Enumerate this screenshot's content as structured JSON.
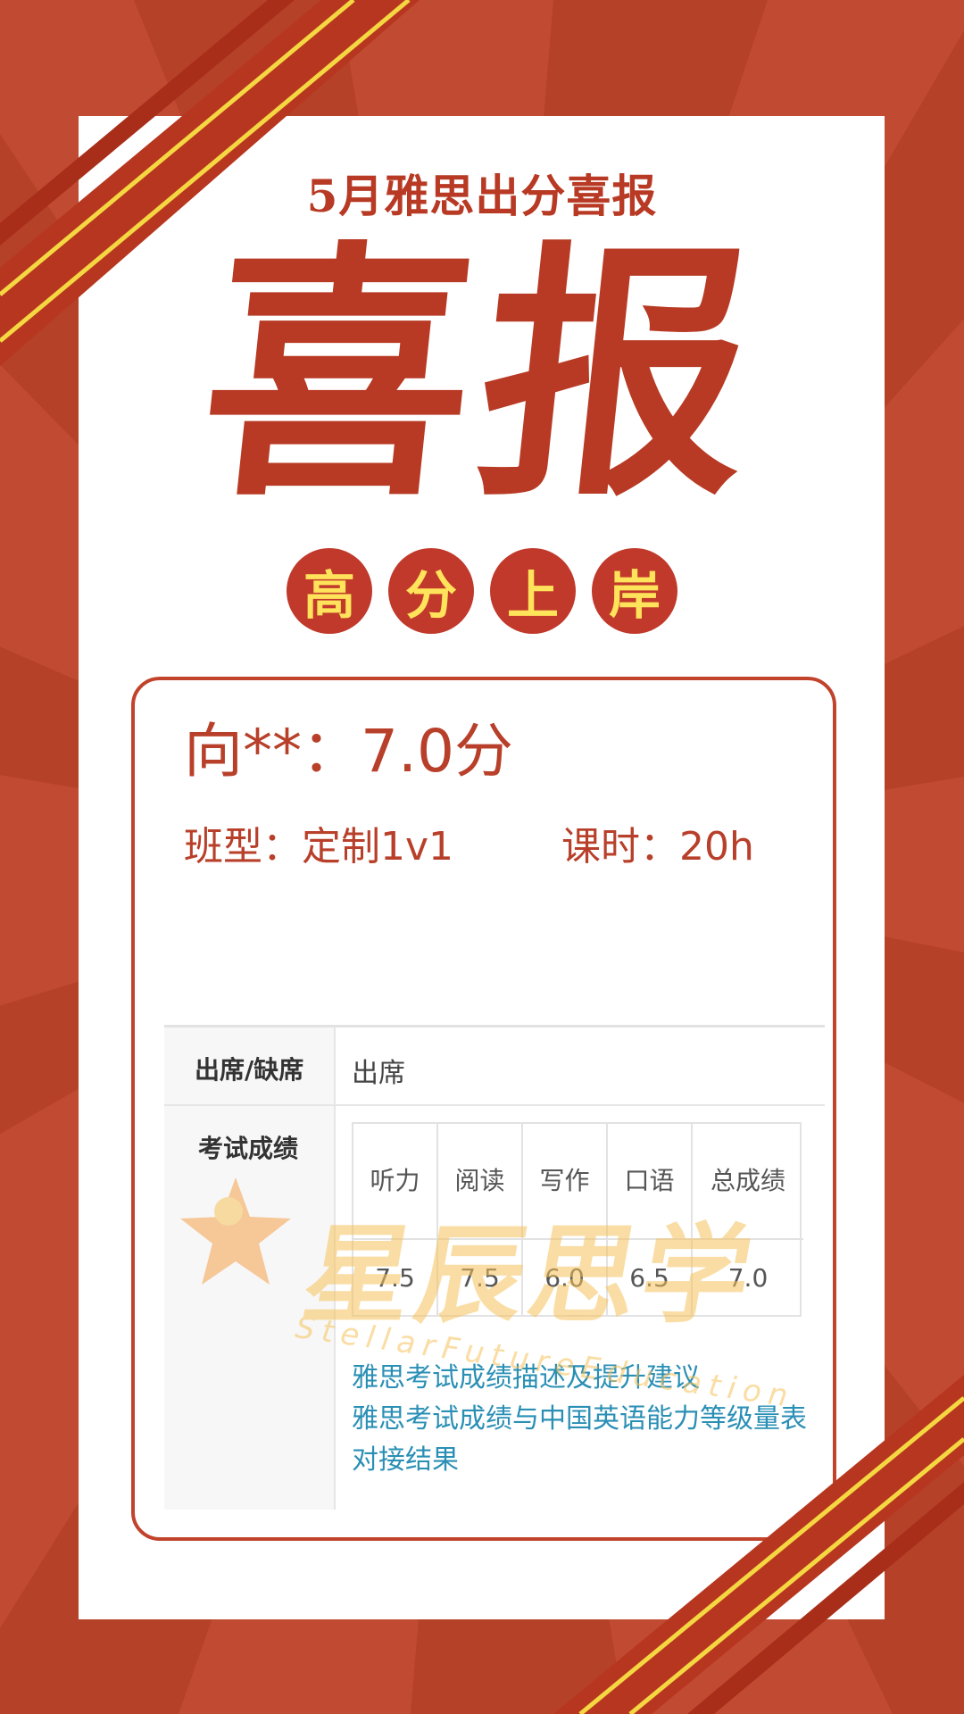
{
  "poster": {
    "subtitle": "5月雅思出分喜报",
    "title": "喜报",
    "badges": [
      "高",
      "分",
      "上",
      "岸"
    ]
  },
  "result": {
    "student_line": "向**：7.0分",
    "class_type": "班型：定制1v1",
    "hours": "课时：20h"
  },
  "score_screenshot": {
    "attendance_label": "出席/缺席",
    "attendance_value": "出席",
    "score_label": "考试成绩",
    "headers": [
      "听力",
      "阅读",
      "写作",
      "口语",
      "总成绩"
    ],
    "scores": [
      "7.5",
      "7.5",
      "6.0",
      "6.5",
      "7.0"
    ],
    "links": [
      "雅思考试成绩描述及提升建议",
      "雅思考试成绩与中国英语能力等级量表对接结果"
    ]
  },
  "watermark": {
    "cn": "星辰思学",
    "en": "StellarFutureEducation"
  },
  "colors": {
    "background": "#c14a32",
    "accent_red": "#b83a24",
    "badge_text": "#ffe35a",
    "link": "#2a8fb5"
  }
}
